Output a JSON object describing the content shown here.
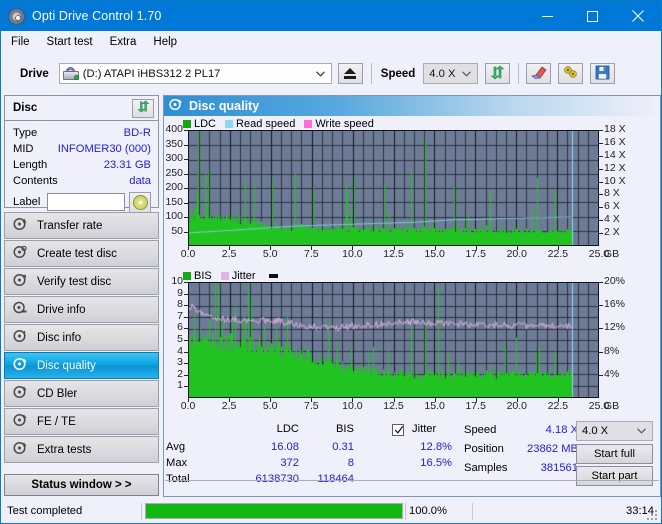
{
  "window": {
    "title": "Opti Drive Control 1.70",
    "icon": "disc-icon",
    "minimize": "–",
    "maximize": "□",
    "close": "✕",
    "accent": "#0078d7"
  },
  "menu": {
    "items": [
      {
        "label": "File"
      },
      {
        "label": "Start test"
      },
      {
        "label": "Extra"
      },
      {
        "label": "Help"
      }
    ]
  },
  "toolbar": {
    "drive_label": "Drive",
    "drive_value": "(D:)   ATAPI iHBS312  2 PL17",
    "eject_icon": "eject-icon",
    "speed_label": "Speed",
    "speed_value": "4.0 X",
    "refresh_icon": "refresh-icon",
    "erase_icon": "eraser-icon",
    "settings_icon": "tools-icon",
    "save_icon": "floppy-save-icon"
  },
  "disc_panel": {
    "header": "Disc",
    "refresh_icon": "refresh-icon",
    "fields": [
      {
        "key": "Type",
        "value": "BD-R"
      },
      {
        "key": "MID",
        "value": "INFOMER30 (000)"
      },
      {
        "key": "Length",
        "value": "23.31 GB"
      },
      {
        "key": "Contents",
        "value": "data"
      }
    ],
    "label_key": "Label",
    "label_value": "",
    "label_placeholder": "",
    "label_button_icon": "cd-icon"
  },
  "nav": {
    "items": [
      {
        "label": "Transfer rate",
        "icon": "disc-speed-icon",
        "selected": false
      },
      {
        "label": "Create test disc",
        "icon": "disc-write-icon",
        "selected": false
      },
      {
        "label": "Verify test disc",
        "icon": "disc-verify-icon",
        "selected": false
      },
      {
        "label": "Drive info",
        "icon": "drive-info-icon",
        "selected": false
      },
      {
        "label": "Disc info",
        "icon": "disc-info-icon",
        "selected": false
      },
      {
        "label": "Disc quality",
        "icon": "disc-quality-icon",
        "selected": true
      },
      {
        "label": "CD Bler",
        "icon": "disc-bler-icon",
        "selected": false
      },
      {
        "label": "FE / TE",
        "icon": "disc-fete-icon",
        "selected": false
      },
      {
        "label": "Extra tests",
        "icon": "disc-extra-icon",
        "selected": false
      }
    ],
    "status_window_button": "Status window > >"
  },
  "content": {
    "header_title": "Disc quality",
    "header_icon": "disc-quality-icon"
  },
  "stats": {
    "col_ldc": "LDC",
    "col_bis": "BIS",
    "row_avg": "Avg",
    "row_max": "Max",
    "row_total": "Total",
    "ldc_avg": "16.08",
    "ldc_max": "372",
    "ldc_total": "6138730",
    "bis_avg": "0.31",
    "bis_max": "8",
    "bis_total": "118464",
    "jitter_label": "Jitter",
    "jitter_checked": true,
    "jitter_avg": "12.8%",
    "jitter_max": "16.5%",
    "speed_label": "Speed",
    "speed_value": "4.18 X",
    "position_label": "Position",
    "position_value": "23862 MB",
    "samples_label": "Samples",
    "samples_value": "381561",
    "speed_select": "4.0 X",
    "start_full": "Start full",
    "start_part": "Start part"
  },
  "statusbar": {
    "message": "Test completed",
    "progress_percent": 100,
    "percent_text": "100.0%",
    "elapsed": "33:14",
    "bar_color": "#12b712"
  },
  "chart_data": [
    {
      "type": "area",
      "id": "ldc-chart",
      "title": "LDC / Read speed / Write speed",
      "xlabel": "GB",
      "ylabel": "",
      "xlim": [
        0.0,
        25.0
      ],
      "xticks": [
        "0.0",
        "2.5",
        "5.0",
        "7.5",
        "10.0",
        "12.5",
        "15.0",
        "17.5",
        "20.0",
        "22.5",
        "25.0"
      ],
      "x_unit_label": "GB",
      "ylim": [
        0,
        400
      ],
      "yticks": [
        "50",
        "100",
        "150",
        "200",
        "250",
        "300",
        "350",
        "400"
      ],
      "y2lim": [
        0,
        18
      ],
      "y2ticks": [
        "2 X",
        "4 X",
        "6 X",
        "8 X",
        "10 X",
        "12 X",
        "14 X",
        "16 X",
        "18 X"
      ],
      "grid": true,
      "plot_bg": "#6d7b96",
      "legend_position": "top-left",
      "legend": [
        {
          "name": "LDC",
          "color": "#21c321"
        },
        {
          "name": "Read speed",
          "color": "#8ad8f5"
        },
        {
          "name": "Write speed",
          "color": "#ff6ad5"
        }
      ],
      "data_end_gb": 23.4,
      "series": [
        {
          "name": "LDC",
          "type": "area-spikes",
          "color": "#21c321",
          "baseline_values": [
            95,
            110,
            120,
            100,
            92,
            88,
            95,
            100,
            95,
            88,
            92,
            95,
            90,
            88,
            85,
            82,
            80,
            78,
            75,
            72,
            70,
            68,
            66,
            64,
            62,
            60,
            58,
            58,
            60,
            62,
            60,
            58,
            56,
            55,
            56,
            57,
            58,
            60,
            62,
            60,
            58,
            56,
            54,
            55,
            56,
            55,
            54,
            53,
            55,
            56,
            55,
            54,
            56,
            58,
            57,
            56,
            55,
            54,
            53,
            52,
            53,
            55,
            54,
            53,
            52,
            51,
            50,
            52,
            53,
            52,
            51,
            50,
            49,
            50,
            52,
            51,
            50,
            49,
            48,
            50,
            52,
            50,
            49,
            48,
            50,
            49,
            48,
            50,
            51,
            49,
            48,
            50,
            49,
            48,
            50,
            49,
            47,
            48,
            50,
            48
          ]
        },
        {
          "name": "Read speed",
          "type": "line",
          "color": "#8ad8f5",
          "values_x_axis2": [
            1.9,
            2.0,
            2.1,
            2.2,
            2.3,
            2.4,
            2.5,
            2.6,
            2.7,
            2.8,
            2.9,
            3.0,
            3.05,
            3.1,
            3.15,
            3.2,
            3.25,
            3.3,
            3.35,
            3.4,
            3.45,
            3.5,
            3.55,
            3.6,
            3.7,
            3.8,
            3.9,
            4.0,
            4.0,
            4.05,
            4.1,
            4.15,
            4.2,
            4.2,
            4.25,
            4.3,
            4.3,
            4.35,
            4.4,
            4.4
          ]
        },
        {
          "name": "Write speed",
          "type": "line",
          "color": "#ff6ad5",
          "values": []
        }
      ]
    },
    {
      "type": "area",
      "id": "bis-chart",
      "title": "BIS / Jitter",
      "xlabel": "GB",
      "xlim": [
        0.0,
        25.0
      ],
      "xticks": [
        "0.0",
        "2.5",
        "5.0",
        "7.5",
        "10.0",
        "12.5",
        "15.0",
        "17.5",
        "20.0",
        "22.5",
        "25.0"
      ],
      "x_unit_label": "GB",
      "ylim": [
        0,
        10
      ],
      "yticks": [
        "1",
        "2",
        "3",
        "4",
        "5",
        "6",
        "7",
        "8",
        "9",
        "10"
      ],
      "y2lim": [
        0,
        20
      ],
      "y2ticks": [
        "4%",
        "8%",
        "12%",
        "16%",
        "20%"
      ],
      "grid": true,
      "plot_bg": "#6d7b96",
      "legend_position": "top-left",
      "legend": [
        {
          "name": "BIS",
          "color": "#21c321"
        },
        {
          "name": "Jitter",
          "color": "#e0b4e0"
        }
      ],
      "data_end_gb": 23.4,
      "series": [
        {
          "name": "BIS",
          "type": "area-spikes",
          "color": "#21c321",
          "baseline_values": [
            5.0,
            5.0,
            4.9,
            4.8,
            4.9,
            5.0,
            4.8,
            4.7,
            4.8,
            4.9,
            4.8,
            4.7,
            4.6,
            4.5,
            4.6,
            4.7,
            4.6,
            4.5,
            4.4,
            4.5,
            4.4,
            4.3,
            4.2,
            4.1,
            4.0,
            4.1,
            4.0,
            3.9,
            3.8,
            3.7,
            3.6,
            3.5,
            3.4,
            3.3,
            3.2,
            3.1,
            3.0,
            2.9,
            2.8,
            2.7,
            2.6,
            2.6,
            2.5,
            2.5,
            2.4,
            2.4,
            2.3,
            2.3,
            2.2,
            2.2,
            2.1,
            2.1,
            2.0,
            2.0,
            2.0,
            2.0,
            2.0,
            2.0,
            2.0,
            2.0,
            2.0,
            2.0,
            2.0,
            2.0,
            2.0,
            2.0,
            2.0,
            2.0,
            2.0,
            2.0,
            2.0,
            2.0,
            2.0,
            2.0,
            2.0,
            2.0,
            2.0,
            2.0,
            2.0,
            2.0,
            2.0,
            2.0,
            2.0,
            2.0,
            2.0,
            2.0,
            2.0,
            2.0,
            2.0,
            2.0,
            2.0,
            2.0,
            2.0,
            2.0,
            2.0,
            2.0,
            2.0,
            2.0,
            2.0,
            2.0
          ]
        },
        {
          "name": "Jitter",
          "type": "line",
          "color": "#e0b4e0",
          "values_percent": [
            15.5,
            16.2,
            15.0,
            14.6,
            14.2,
            14.4,
            14.0,
            13.8,
            14.0,
            13.6,
            13.8,
            13.5,
            13.7,
            13.4,
            13.6,
            13.3,
            13.5,
            13.2,
            13.4,
            13.6,
            13.3,
            13.0,
            13.2,
            13.5,
            13.1,
            12.9,
            13.0,
            12.7,
            12.5,
            12.6,
            12.4,
            12.2,
            12.3,
            12.1,
            12.3,
            12.2,
            12.4,
            12.2,
            12.0,
            12.2,
            12.4,
            12.2,
            12.5,
            12.3,
            12.6,
            12.4,
            12.7,
            12.5,
            12.8,
            12.6,
            12.9,
            12.7,
            13.0,
            12.8,
            13.1,
            12.9,
            13.2,
            13.0,
            13.3,
            13.1,
            13.0,
            12.8,
            13.0,
            12.9,
            13.1,
            12.9,
            13.0,
            12.8,
            12.9,
            12.7,
            12.9,
            13.0,
            12.8,
            12.6,
            12.8,
            12.7,
            12.9,
            12.7,
            12.5,
            12.7,
            12.6,
            12.8,
            12.6,
            12.4,
            12.6,
            12.5,
            12.7,
            12.5,
            12.3,
            12.5,
            12.4,
            12.6,
            12.4,
            12.2,
            12.4,
            12.3,
            12.5,
            12.3,
            12.6,
            12.4
          ]
        }
      ]
    }
  ]
}
